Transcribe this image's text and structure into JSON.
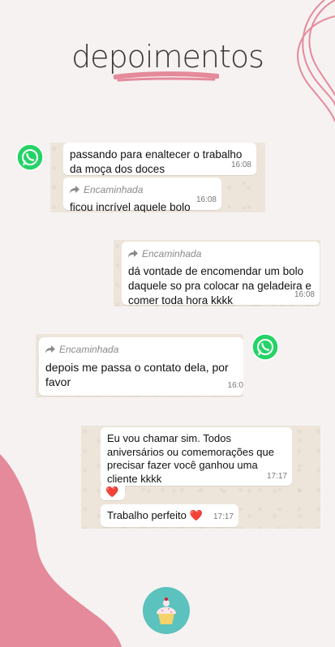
{
  "header": {
    "title": "depoimentos"
  },
  "screenshot1": {
    "msg1": {
      "text": "passando para enaltecer o trabalho da moça dos doces",
      "time": "16:08"
    },
    "msg2": {
      "forward_label": "Encaminhada",
      "text": "ficou incrível aquele bolo",
      "time": "16:08"
    }
  },
  "screenshot2": {
    "msg1": {
      "forward_label": "Encaminhada",
      "text": "dá vontade de encomendar um bolo daquele so pra colocar na geladeira e comer toda hora kkkk",
      "time": "16:08"
    }
  },
  "screenshot3": {
    "msg1": {
      "forward_label": "Encaminhada",
      "text": "depois me passa o contato dela, por favor",
      "time": "16:0"
    }
  },
  "screenshot4": {
    "msg1": {
      "text": "Eu vou chamar sim. Todos aniversários ou comemorações que precisar fazer você ganhou uma cliente kkkk",
      "time": "17:17"
    },
    "msg2": {
      "emoji": "❤️"
    },
    "msg3": {
      "text": "Trabalho perfeito",
      "emoji": "❤️",
      "time": "17:17"
    }
  },
  "icons": [
    "whatsapp-icon",
    "forward-arrow-icon",
    "heart-icon",
    "cupcake-logo-icon"
  ],
  "colors": {
    "pink": "#e58a9a",
    "background": "#f6f2f2",
    "whatsapp_green": "#25d366",
    "teal": "#5cc2bd"
  }
}
